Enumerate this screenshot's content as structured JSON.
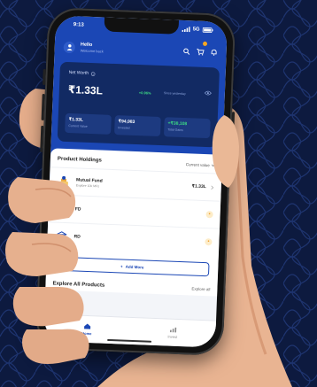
{
  "status": {
    "time": "9:13",
    "network": "5G"
  },
  "header": {
    "user_name": "Hello",
    "user_sub": "Welcome back"
  },
  "net_worth": {
    "label": "Net Worth",
    "value": "₹1.33L",
    "change": "+0.96%",
    "since": "Since yesterday",
    "stats": [
      {
        "value": "₹1.33L",
        "label": "Current Value"
      },
      {
        "value": "₹94,983",
        "label": "Invested"
      },
      {
        "value": "+₹38,108",
        "label": "Total Gains"
      }
    ]
  },
  "holdings": {
    "title": "Product Holdings",
    "current_value_label": "Current value",
    "items": [
      {
        "name": "Mutual Fund",
        "sub": "Explore 10k MFs",
        "amount": "₹1.33L"
      },
      {
        "name": "FD",
        "sub": "",
        "amount": ""
      },
      {
        "name": "RD",
        "sub": "",
        "amount": ""
      }
    ],
    "add_more_label": "Add More"
  },
  "explore": {
    "title": "Explore All Products",
    "link": "Explore all"
  },
  "tabs": [
    {
      "label": "Home"
    },
    {
      "label": "Invest"
    }
  ],
  "colors": {
    "primary": "#1b47b5",
    "card": "#122a63",
    "background": "#0d1a3f",
    "accent": "#f5a623",
    "gain": "#3ddc84"
  }
}
